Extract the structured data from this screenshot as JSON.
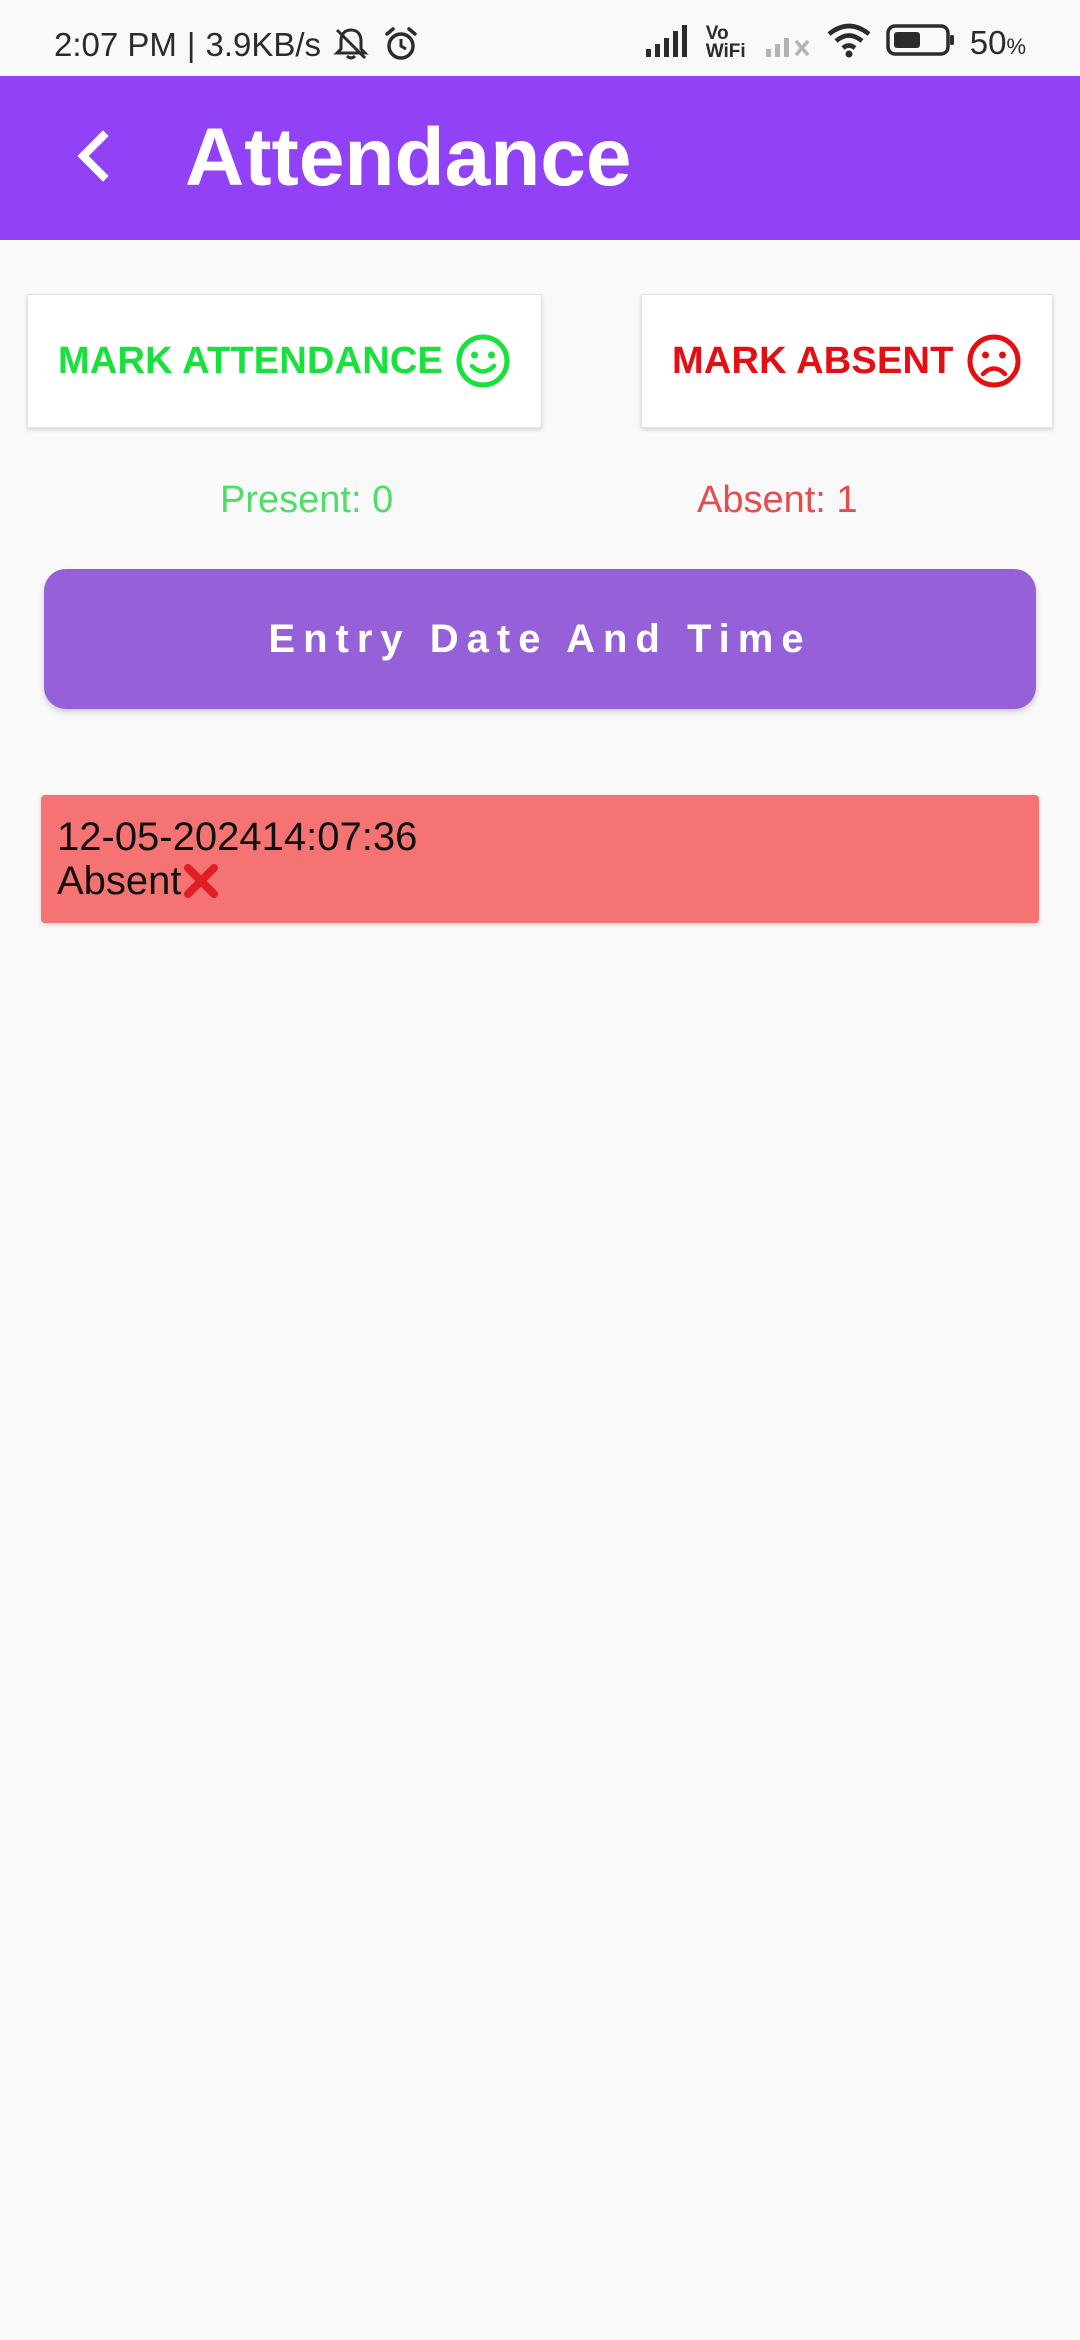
{
  "status_bar": {
    "time": "2:07 PM",
    "separator": "|",
    "speed": "3.9KB/s",
    "vowifi_top": "Vo",
    "vowifi_bottom": "WiFi",
    "battery_value": "50",
    "battery_unit": "%",
    "icons": [
      "silent-bell-icon",
      "alarm-icon",
      "signal-icon",
      "vowifi-icon",
      "signal-off-icon",
      "wifi-icon",
      "battery-icon"
    ]
  },
  "app_bar": {
    "title": "Attendance",
    "back_icon": "chevron-left-icon",
    "color": "#9142f7"
  },
  "actions": {
    "mark_attendance": "MARK ATTENDANCE",
    "mark_attendance_icon": "smiley-icon",
    "mark_attendance_color": "#18e13c",
    "mark_absent": "MARK ABSENT",
    "mark_absent_icon": "sad-face-icon",
    "mark_absent_color": "#e30f13"
  },
  "counts": {
    "present": "Present: 0",
    "absent": "Absent: 1"
  },
  "entry_button": {
    "label": "Entry Date And Time",
    "color": "#9560d8"
  },
  "records": [
    {
      "date": "12-05-2024",
      "time": "14:07:36",
      "status": "Absent",
      "status_icon": "red-x-icon",
      "color": "#f57373"
    }
  ]
}
